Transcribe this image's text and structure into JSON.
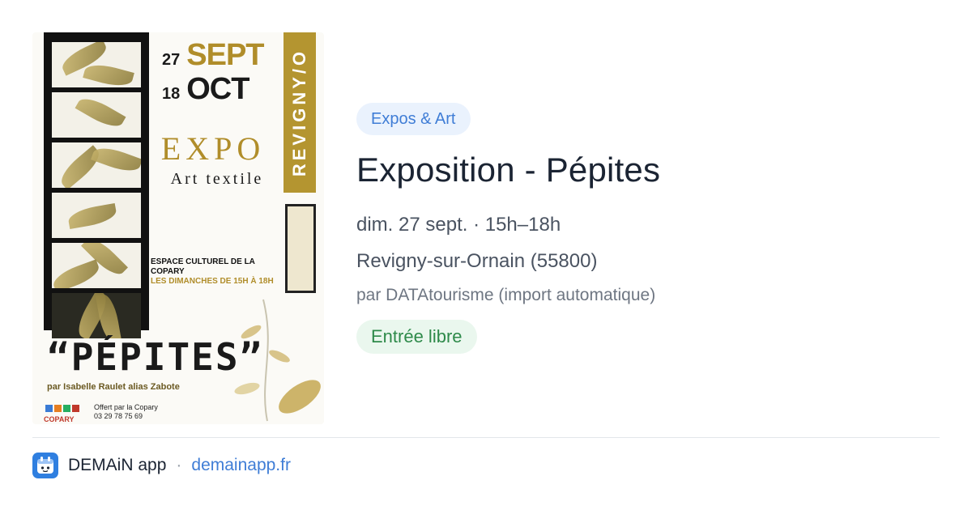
{
  "poster": {
    "date_day_1": "27",
    "date_month_1": "SEPT",
    "date_day_2": "18",
    "date_month_2": "OCT",
    "side_label": "REVIGNY/O",
    "expo": "EXPO",
    "expo_sub": "Art textile",
    "venue_line_1": "ESPACE CULTUREL DE LA",
    "venue_line_2": "COPARY",
    "venue_hours": "LES DIMANCHES DE 15H À 18H",
    "name": "“PÉPITES”",
    "author": "par Isabelle Raulet alias Zabote",
    "offer_line_1": "Offert par la Copary",
    "offer_line_2": "03 29 78 75 69",
    "logo_text": "COPARY"
  },
  "event": {
    "category": "Expos & Art",
    "title": "Exposition - Pépites",
    "when": "dim. 27 sept. · 15h–18h",
    "where": "Revigny-sur-Ornain (55800)",
    "by": "par DATAtourisme (import automatique)",
    "price": "Entrée libre"
  },
  "footer": {
    "app_name": "DEMAiN app",
    "separator": "·",
    "url": "demainapp.fr"
  },
  "colors": {
    "accent_blue": "#3f7dd6",
    "badge_bg": "#eaf2fd",
    "green_text": "#2e8a4a",
    "green_bg": "#eaf7ee",
    "poster_gold": "#b08d2a"
  }
}
